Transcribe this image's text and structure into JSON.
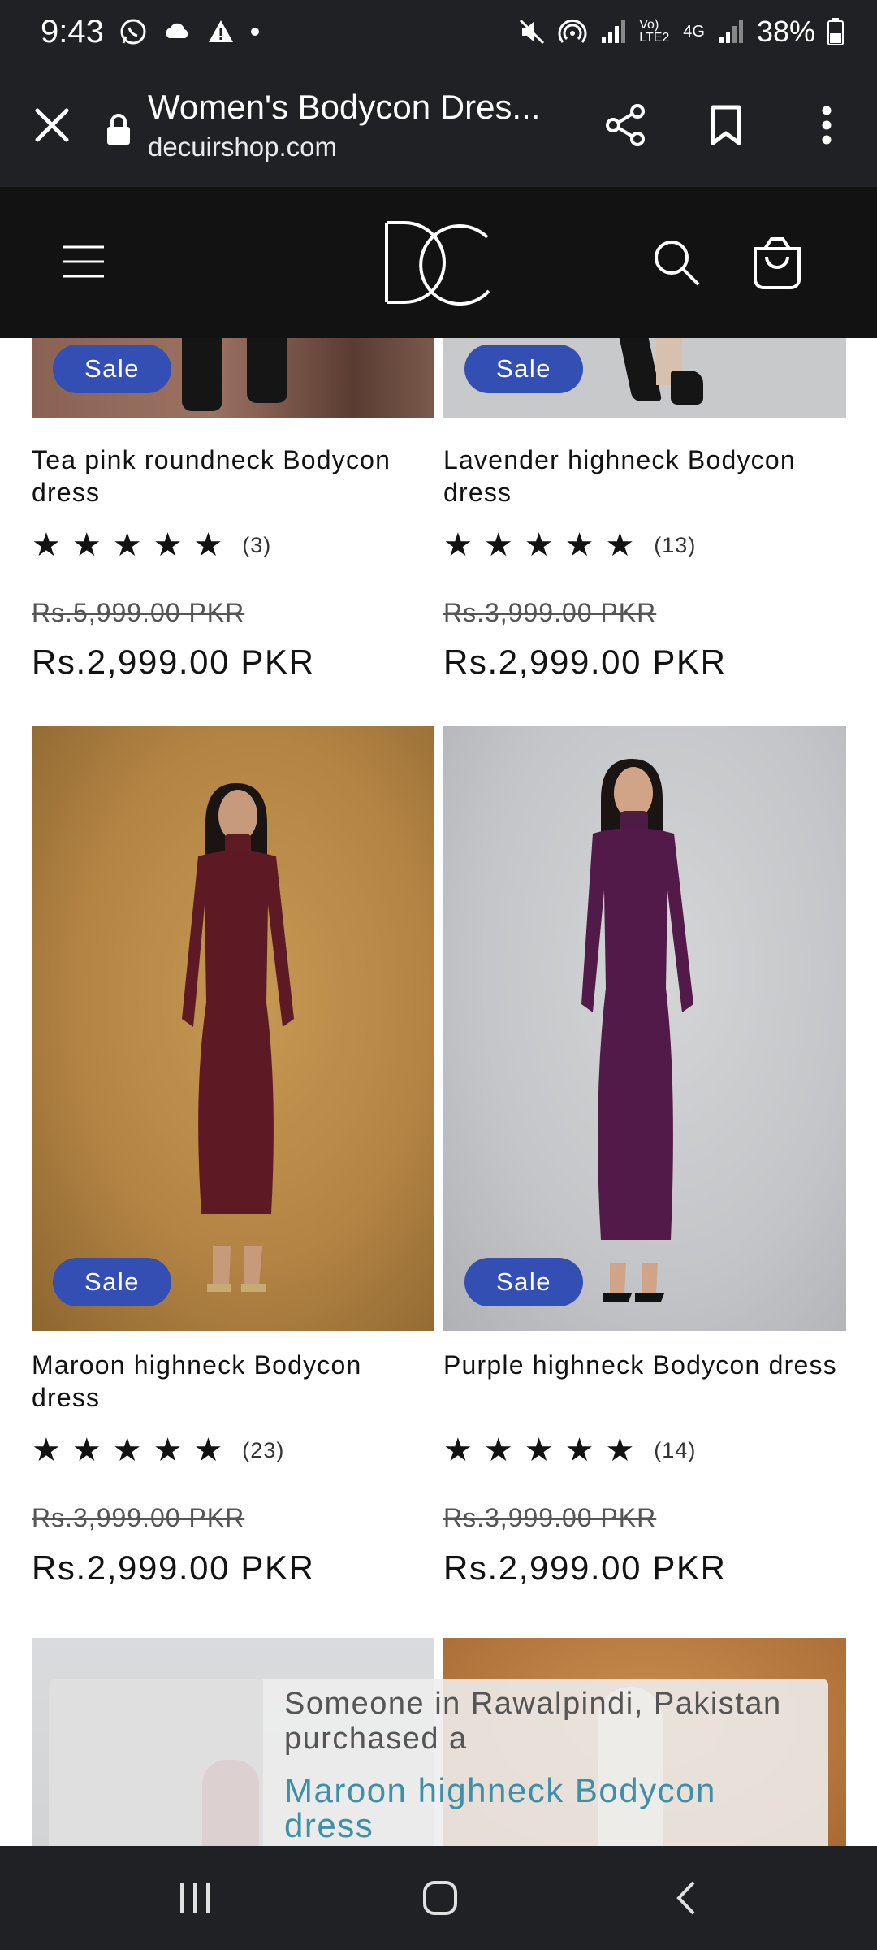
{
  "status_bar": {
    "time": "9:43",
    "battery": "38%",
    "network_label": "Vo) LTE2",
    "network_type": "4G"
  },
  "browser": {
    "page_title": "Women's Bodycon Dres...",
    "url": "decuirshop.com",
    "icons": [
      "close-icon",
      "lock-icon",
      "share-icon",
      "bookmark-icon",
      "more-vert-icon"
    ]
  },
  "site_header": {
    "logo_text": "DC",
    "icons": [
      "menu-icon",
      "search-icon",
      "cart-icon"
    ]
  },
  "sale_badge_label": "Sale",
  "products": [
    {
      "name": "Tea pink roundneck Bodycon dress",
      "rating": 5,
      "stars": "★★★★★",
      "reviews": "(3)",
      "original_price": "Rs.5,999.00 PKR",
      "sale_price": "Rs.2,999.00 PKR",
      "badge": "Sale"
    },
    {
      "name": "Lavender highneck Bodycon dress",
      "rating": 5,
      "stars": "★★★★★",
      "reviews": "(13)",
      "original_price": "Rs.3,999.00 PKR",
      "sale_price": "Rs.2,999.00 PKR",
      "badge": "Sale"
    },
    {
      "name": "Maroon highneck Bodycon dress",
      "rating": 5,
      "stars": "★★★★★",
      "reviews": "(23)",
      "original_price": "Rs.3,999.00 PKR",
      "sale_price": "Rs.2,999.00 PKR",
      "badge": "Sale"
    },
    {
      "name": "Purple highneck Bodycon dress",
      "rating": 5,
      "stars": "★★★★★",
      "reviews": "(14)",
      "original_price": "Rs.3,999.00 PKR",
      "sale_price": "Rs.2,999.00 PKR",
      "badge": "Sale"
    }
  ],
  "toast": {
    "message": "Someone in Rawalpindi, Pakistan purchased a",
    "product_link": "Maroon highneck Bodycon dress"
  },
  "nav_bar": {
    "icons": [
      "recent-apps-icon",
      "home-icon",
      "back-icon"
    ]
  },
  "colors": {
    "chrome_bg": "#202124",
    "header_bg": "#121212",
    "sale_badge": "#334fb4",
    "toast_link": "#3e90a8"
  }
}
